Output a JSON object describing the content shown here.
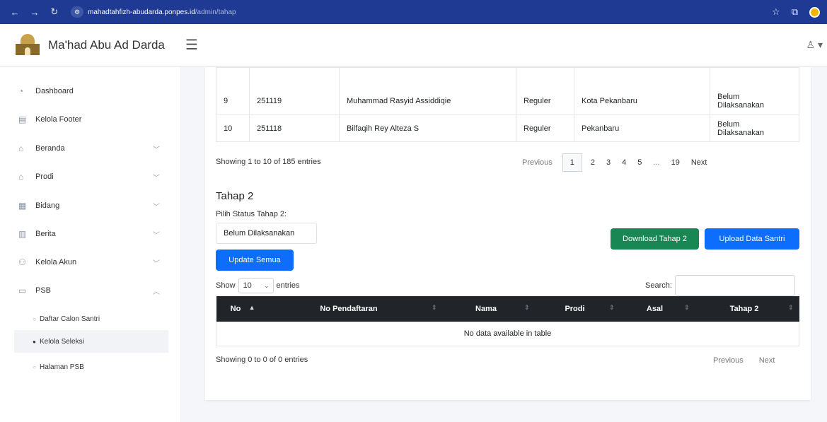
{
  "browser": {
    "url_host": "mahadtahfizh-abudarda.ponpes.id",
    "url_path": "/admin/tahap"
  },
  "header": {
    "brand": "Ma'had Abu Ad Darda"
  },
  "sidebar": {
    "items": [
      {
        "label": "Dashboard",
        "icon": "speedometer-icon"
      },
      {
        "label": "Kelola Footer",
        "icon": "layout-icon"
      },
      {
        "label": "Beranda",
        "icon": "home-icon"
      },
      {
        "label": "Prodi",
        "icon": "building-icon"
      },
      {
        "label": "Bidang",
        "icon": "grid-icon"
      },
      {
        "label": "Berita",
        "icon": "newspaper-icon"
      },
      {
        "label": "Kelola Akun",
        "icon": "users-icon"
      },
      {
        "label": "PSB",
        "icon": "folder-icon"
      }
    ],
    "psb_subitems": [
      {
        "label": "Daftar Calon Santri"
      },
      {
        "label": "Kelola Seleksi"
      },
      {
        "label": "Halaman PSB"
      }
    ]
  },
  "tahap1_table": {
    "rows": [
      {
        "no": "9",
        "nomor": "251119",
        "nama": "Muhammad Rasyid Assiddiqie",
        "prodi": "Reguler",
        "asal": "Kota Pekanbaru",
        "status_1": "Belum",
        "status_2": "Dilaksanakan"
      },
      {
        "no": "10",
        "nomor": "251118",
        "nama": "Bilfaqih Rey Alteza S",
        "prodi": "Reguler",
        "asal": "Pekanbaru",
        "status_1": "Belum",
        "status_2": "Dilaksanakan"
      }
    ],
    "info": "Showing 1 to 10 of 185 entries",
    "pagination": {
      "previous": "Previous",
      "pages": [
        "1",
        "2",
        "3",
        "4",
        "5",
        "...",
        "19"
      ],
      "next": "Next"
    }
  },
  "tahap2": {
    "title": "Tahap 2",
    "status_label": "Pilih Status Tahap 2:",
    "status_value": "Belum Dilaksanakan",
    "update_button": "Update Semua",
    "download_button": "Download Tahap 2",
    "upload_button": "Upload Data Santri",
    "show_label": "Show",
    "entries_value": "10",
    "entries_label": "entries",
    "search_label": "Search:",
    "columns": [
      "No",
      "No Pendaftaran",
      "Nama",
      "Prodi",
      "Asal",
      "Tahap 2"
    ],
    "empty_message": "No data available in table",
    "info": "Showing 0 to 0 of 0 entries",
    "previous": "Previous",
    "next": "Next"
  }
}
